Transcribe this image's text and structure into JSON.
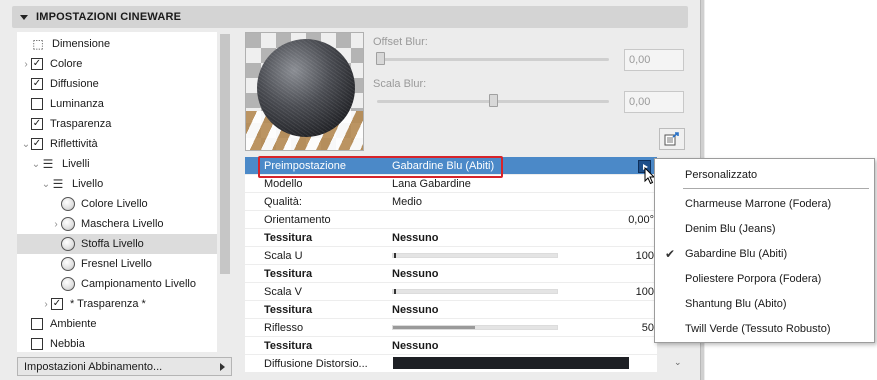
{
  "header": {
    "title": "IMPOSTAZIONI CINEWARE"
  },
  "tree": [
    {
      "label": "Dimensione",
      "icon": "dimension-icon",
      "checked": null
    },
    {
      "label": "Colore",
      "checked": true
    },
    {
      "label": "Diffusione",
      "checked": true
    },
    {
      "label": "Luminanza",
      "checked": false
    },
    {
      "label": "Trasparenza",
      "checked": true
    },
    {
      "label": "Riflettività",
      "checked": true
    },
    {
      "label": "Livelli",
      "icon": "layers-icon"
    },
    {
      "label": "Livello",
      "icon": "layers-icon"
    },
    {
      "label": "Colore Livello"
    },
    {
      "label": "Maschera Livello"
    },
    {
      "label": "Stoffa Livello",
      "selected": true
    },
    {
      "label": "Fresnel Livello"
    },
    {
      "label": "Campionamento Livello"
    },
    {
      "label": "* Trasparenza *",
      "checked": true
    },
    {
      "label": "Ambiente",
      "checked": false
    },
    {
      "label": "Nebbia",
      "checked": false
    }
  ],
  "assign_button": {
    "label": "Impostazioni Abbinamento..."
  },
  "sliders": {
    "offset_blur": {
      "label": "Offset Blur:",
      "value": "0,00",
      "level": 0.0
    },
    "scala_blur": {
      "label": "Scala Blur:",
      "value": "0,00",
      "level": 0.5
    }
  },
  "properties": [
    {
      "key": "Preimpostazione",
      "value": "Gabardine Blu (Abiti)",
      "selected": true
    },
    {
      "key": "Modello",
      "value": "Lana Gabardine"
    },
    {
      "key": "Qualità:",
      "value": "Medio"
    },
    {
      "key": "Orientamento",
      "right": "0,00°"
    },
    {
      "key": "Tessitura",
      "value": "Nessuno",
      "bold": true
    },
    {
      "key": "Scala U",
      "right": "100",
      "level": 0.01
    },
    {
      "key": "Tessitura",
      "value": "Nessuno",
      "bold": true
    },
    {
      "key": "Scala V",
      "right": "100",
      "level": 0.01
    },
    {
      "key": "Tessitura",
      "value": "Nessuno",
      "bold": true
    },
    {
      "key": "Riflesso",
      "right": "50",
      "level": 0.5
    },
    {
      "key": "Tessitura",
      "value": "Nessuno",
      "bold": true
    },
    {
      "key": "Diffusione Distorsio...",
      "swatch": "#1d1f24"
    }
  ],
  "preset_menu": {
    "items": [
      {
        "label": "Personalizzato"
      },
      {
        "label": "Charmeuse Marrone (Fodera)"
      },
      {
        "label": "Denim Blu (Jeans)"
      },
      {
        "label": "Gabardine Blu (Abiti)",
        "checked": true
      },
      {
        "label": "Poliestere Porpora (Fodera)"
      },
      {
        "label": "Shantung Blu (Abito)"
      },
      {
        "label": "Twill Verde (Tessuto Robusto)"
      }
    ]
  },
  "colors": {
    "selection": "#4b89c8",
    "highlight": "#d6232a"
  }
}
